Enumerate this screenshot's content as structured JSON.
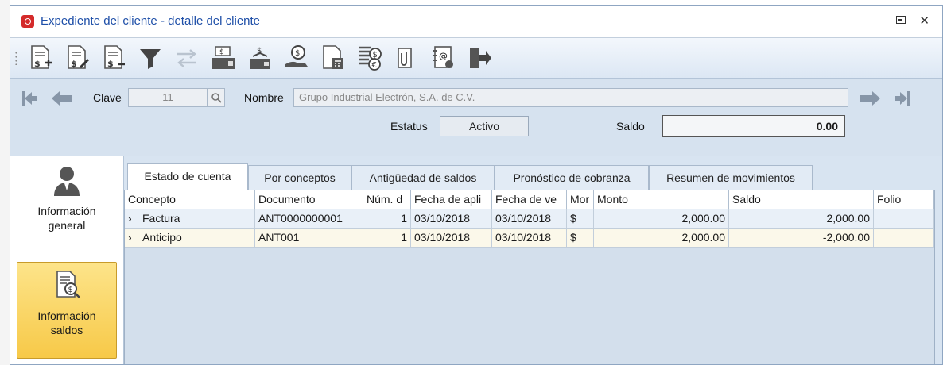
{
  "window": {
    "title": "Expediente del cliente - detalle del cliente"
  },
  "toolbar": {
    "icons": [
      "add-invoice-icon",
      "edit-invoice-icon",
      "remove-invoice-icon",
      "filter-icon",
      "transfer-icon",
      "cash-register-icon",
      "payment-icon",
      "money-hand-icon",
      "calculator-document-icon",
      "currency-document-icon",
      "attachment-icon",
      "email-contact-icon",
      "exit-icon"
    ]
  },
  "header": {
    "clave_label": "Clave",
    "clave_value": "11",
    "nombre_label": "Nombre",
    "nombre_value": "Grupo Industrial Electrón, S.A. de C.V.",
    "estatus_label": "Estatus",
    "estatus_value": "Activo",
    "saldo_label": "Saldo",
    "saldo_value": "0.00"
  },
  "sidebar": {
    "items": [
      {
        "label_1": "Información",
        "label_2": "general",
        "icon": "person-icon"
      },
      {
        "label_1": "Información",
        "label_2": "saldos",
        "icon": "balance-search-icon"
      }
    ]
  },
  "tabs": [
    "Estado de cuenta",
    "Por conceptos",
    "Antigüedad de saldos",
    "Pronóstico de cobranza",
    "Resumen de movimientos"
  ],
  "grid": {
    "columns": [
      "Concepto",
      "Documento",
      "Núm. d",
      "Fecha de apli",
      "Fecha de ve",
      "Mor",
      "Monto",
      "Saldo",
      "Folio"
    ],
    "rows": [
      [
        "Factura",
        "ANT0000000001",
        "1",
        "03/10/2018",
        "03/10/2018",
        "$",
        "2,000.00",
        "2,000.00",
        ""
      ],
      [
        "Anticipo",
        "ANT001",
        "1",
        "03/10/2018",
        "03/10/2018",
        "$",
        "2,000.00",
        "-2,000.00",
        ""
      ]
    ]
  },
  "colors": {
    "title": "#1e4fa8",
    "active_sidebar": "#f7c948",
    "window_bg": "#d8e4f1"
  }
}
